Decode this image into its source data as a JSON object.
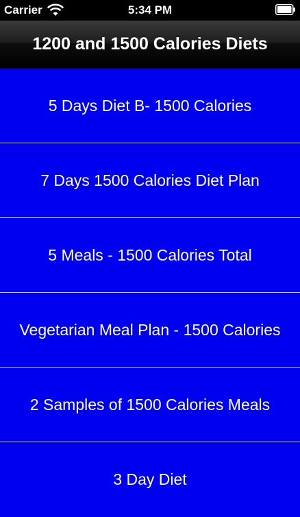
{
  "status_bar": {
    "carrier": "Carrier",
    "time": "5:34 PM",
    "wifi_icon": "wifi-icon",
    "battery_icon": "battery-icon"
  },
  "nav": {
    "title": "1200 and 1500 Calories Diets"
  },
  "list": {
    "items": [
      {
        "label": "5 Days Diet B- 1500 Calories"
      },
      {
        "label": "7 Days 1500 Calories Diet Plan"
      },
      {
        "label": "5 Meals - 1500 Calories Total"
      },
      {
        "label": "Vegetarian Meal Plan - 1500 Calories"
      },
      {
        "label": "2 Samples of 1500 Calories Meals"
      },
      {
        "label": "3 Day Diet"
      }
    ]
  },
  "colors": {
    "list_background": "#0000f0",
    "separator": "#d0d0ff",
    "text": "#ffffff",
    "nav_bar": "#000000"
  }
}
